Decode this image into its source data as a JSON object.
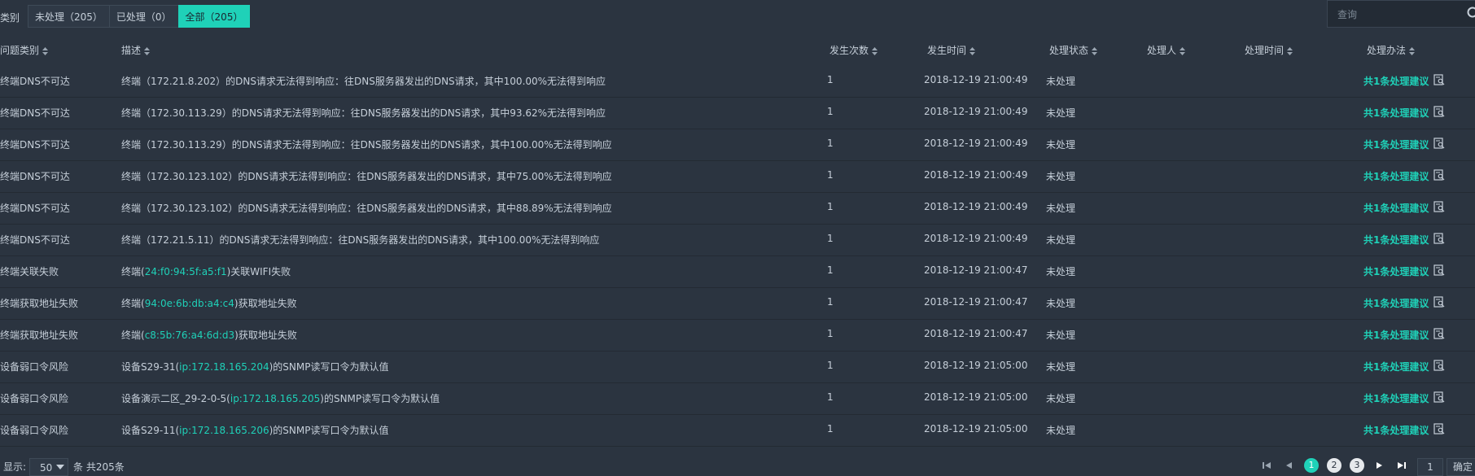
{
  "toolbar": {
    "category_label": "类别",
    "filters": [
      {
        "label": "未处理（205）"
      },
      {
        "label": "已处理（0）"
      },
      {
        "label": "全部（205）",
        "active": true
      }
    ],
    "search_placeholder": "查询"
  },
  "table": {
    "headers": {
      "type": "问题类别",
      "desc": "描述",
      "count": "发生次数",
      "time": "发生时间",
      "status": "处理状态",
      "handler": "处理人",
      "handle_time": "处理时间",
      "method": "处理办法"
    },
    "rows": [
      {
        "type": "终端DNS不可达",
        "desc": [
          {
            "t": "终端（172.21.8.202）的DNS请求无法得到响应：往DNS服务器发出的DNS请求，其中100.00%无法得到响应"
          }
        ],
        "count": "1",
        "time": "2018-12-19 21:00:49",
        "status": "未处理",
        "handler": "",
        "handle_time": "",
        "advice": "共1条处理建议"
      },
      {
        "type": "终端DNS不可达",
        "desc": [
          {
            "t": "终端（172.30.113.29）的DNS请求无法得到响应：往DNS服务器发出的DNS请求，其中93.62%无法得到响应"
          }
        ],
        "count": "1",
        "time": "2018-12-19 21:00:49",
        "status": "未处理",
        "handler": "",
        "handle_time": "",
        "advice": "共1条处理建议"
      },
      {
        "type": "终端DNS不可达",
        "desc": [
          {
            "t": "终端（172.30.113.29）的DNS请求无法得到响应：往DNS服务器发出的DNS请求，其中100.00%无法得到响应"
          }
        ],
        "count": "1",
        "time": "2018-12-19 21:00:49",
        "status": "未处理",
        "handler": "",
        "handle_time": "",
        "advice": "共1条处理建议"
      },
      {
        "type": "终端DNS不可达",
        "desc": [
          {
            "t": "终端（172.30.123.102）的DNS请求无法得到响应：往DNS服务器发出的DNS请求，其中75.00%无法得到响应"
          }
        ],
        "count": "1",
        "time": "2018-12-19 21:00:49",
        "status": "未处理",
        "handler": "",
        "handle_time": "",
        "advice": "共1条处理建议"
      },
      {
        "type": "终端DNS不可达",
        "desc": [
          {
            "t": "终端（172.30.123.102）的DNS请求无法得到响应：往DNS服务器发出的DNS请求，其中88.89%无法得到响应"
          }
        ],
        "count": "1",
        "time": "2018-12-19 21:00:49",
        "status": "未处理",
        "handler": "",
        "handle_time": "",
        "advice": "共1条处理建议"
      },
      {
        "type": "终端DNS不可达",
        "desc": [
          {
            "t": "终端（172.21.5.11）的DNS请求无法得到响应：往DNS服务器发出的DNS请求，其中100.00%无法得到响应"
          }
        ],
        "count": "1",
        "time": "2018-12-19 21:00:49",
        "status": "未处理",
        "handler": "",
        "handle_time": "",
        "advice": "共1条处理建议"
      },
      {
        "type": "终端关联失败",
        "desc": [
          {
            "t": "终端("
          },
          {
            "t": "24:f0:94:5f:a5:f1",
            "hl": true
          },
          {
            "t": ")关联WIFI失败"
          }
        ],
        "count": "1",
        "time": "2018-12-19 21:00:47",
        "status": "未处理",
        "handler": "",
        "handle_time": "",
        "advice": "共1条处理建议"
      },
      {
        "type": "终端获取地址失败",
        "desc": [
          {
            "t": "终端("
          },
          {
            "t": "94:0e:6b:db:a4:c4",
            "hl": true
          },
          {
            "t": ")获取地址失败"
          }
        ],
        "count": "1",
        "time": "2018-12-19 21:00:47",
        "status": "未处理",
        "handler": "",
        "handle_time": "",
        "advice": "共1条处理建议"
      },
      {
        "type": "终端获取地址失败",
        "desc": [
          {
            "t": "终端("
          },
          {
            "t": "c8:5b:76:a4:6d:d3",
            "hl": true
          },
          {
            "t": ")获取地址失败"
          }
        ],
        "count": "1",
        "time": "2018-12-19 21:00:47",
        "status": "未处理",
        "handler": "",
        "handle_time": "",
        "advice": "共1条处理建议"
      },
      {
        "type": "设备弱口令风险",
        "desc": [
          {
            "t": "设备S29-31("
          },
          {
            "t": "ip:172.18.165.204",
            "hl": true
          },
          {
            "t": ")的SNMP读写口令为默认值"
          }
        ],
        "count": "1",
        "time": "2018-12-19 21:05:00",
        "status": "未处理",
        "handler": "",
        "handle_time": "",
        "advice": "共1条处理建议"
      },
      {
        "type": "设备弱口令风险",
        "desc": [
          {
            "t": "设备演示二区_29-2-0-5("
          },
          {
            "t": "ip:172.18.165.205",
            "hl": true
          },
          {
            "t": ")的SNMP读写口令为默认值"
          }
        ],
        "count": "1",
        "time": "2018-12-19 21:05:00",
        "status": "未处理",
        "handler": "",
        "handle_time": "",
        "advice": "共1条处理建议"
      },
      {
        "type": "设备弱口令风险",
        "desc": [
          {
            "t": "设备S29-11("
          },
          {
            "t": "ip:172.18.165.206",
            "hl": true
          },
          {
            "t": ")的SNMP读写口令为默认值"
          }
        ],
        "count": "1",
        "time": "2018-12-19 21:05:00",
        "status": "未处理",
        "handler": "",
        "handle_time": "",
        "advice": "共1条处理建议"
      }
    ]
  },
  "footer": {
    "show_label": "显示:",
    "page_size": "50",
    "total_label": "条 共205条",
    "pages": [
      {
        "label": "1",
        "active": true
      },
      {
        "label": "2"
      },
      {
        "label": "3"
      }
    ],
    "goto_value": "1",
    "confirm_label": "确定"
  },
  "colors": {
    "accent": "#1fd1b8",
    "background": "#2b3440",
    "text": "#c6cfd9"
  }
}
